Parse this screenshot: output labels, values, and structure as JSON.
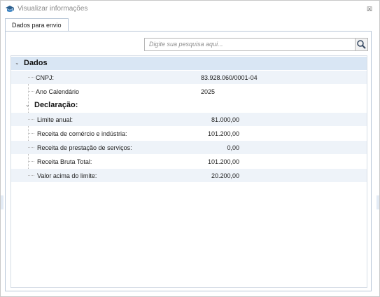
{
  "window": {
    "title": "Visualizar informações",
    "close_glyph": "☒"
  },
  "tabs": [
    {
      "label": "Dados para envio",
      "active": true
    }
  ],
  "search": {
    "placeholder": "Digite sua pesquisa aqui...",
    "value": "",
    "icon": "search-icon"
  },
  "tree": {
    "root": {
      "label": "Dados",
      "expanded": true,
      "items": [
        {
          "label": "CNPJ:",
          "value": "83.928.060/0001-04"
        },
        {
          "label": "Ano Calendário",
          "value": "2025"
        }
      ],
      "subgroup": {
        "label": "Declaração:",
        "expanded": true,
        "items": [
          {
            "label": "Limite anual:",
            "value": "81.000,00"
          },
          {
            "label": "Receita de comércio e indústria:",
            "value": "101.200,00"
          },
          {
            "label": "Receita de prestação de serviços:",
            "value": "0,00"
          },
          {
            "label": "Receita Bruta Total:",
            "value": "101.200,00"
          },
          {
            "label": "Valor acima do limite:",
            "value": "20.200,00"
          }
        ]
      }
    }
  },
  "colors": {
    "header_row": "#d9e6f4",
    "alt_row": "#eef3f9",
    "tab_border": "#b9c7d8"
  }
}
